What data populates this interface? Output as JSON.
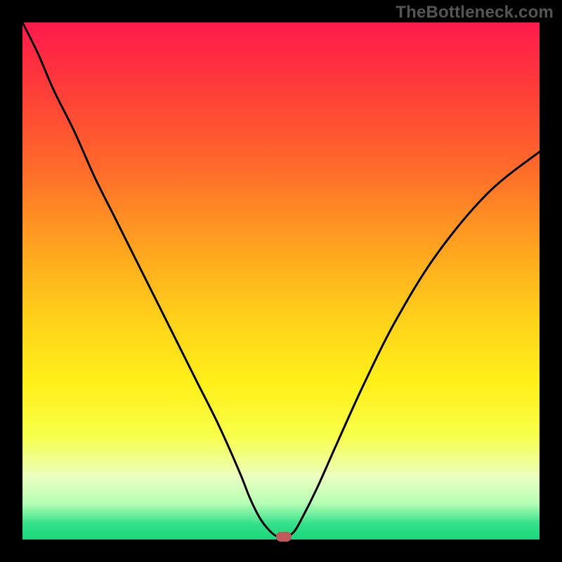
{
  "watermark": "TheBottleneck.com",
  "colors": {
    "frame": "#000000",
    "curve": "#000000",
    "marker": "#c05a5a"
  },
  "chart_data": {
    "type": "line",
    "title": "",
    "xlabel": "",
    "ylabel": "",
    "xlim": [
      0,
      100
    ],
    "ylim": [
      0,
      100
    ],
    "grid": false,
    "legend": false,
    "series": [
      {
        "name": "bottleneck-curve",
        "x": [
          0,
          3,
          6,
          10,
          14,
          18,
          22,
          26,
          30,
          34,
          38,
          42,
          44,
          46,
          48,
          49.5,
          51,
          52.5,
          54,
          57,
          61,
          66,
          72,
          80,
          90,
          100
        ],
        "y": [
          100,
          94,
          87,
          79,
          70,
          62,
          54,
          46,
          38,
          30,
          22,
          13,
          8,
          4,
          1.5,
          0.5,
          0.5,
          1.5,
          4,
          10,
          19,
          30,
          42,
          55,
          67,
          75
        ]
      }
    ],
    "marker": {
      "x": 50.5,
      "y": 0.5
    },
    "gradient_stops": [
      {
        "pos": 0.0,
        "color": "#ff1a4d"
      },
      {
        "pos": 0.12,
        "color": "#ff3a3a"
      },
      {
        "pos": 0.28,
        "color": "#ff6a2a"
      },
      {
        "pos": 0.44,
        "color": "#ffa51f"
      },
      {
        "pos": 0.58,
        "color": "#ffd31a"
      },
      {
        "pos": 0.7,
        "color": "#fff01a"
      },
      {
        "pos": 0.8,
        "color": "#f8ff4a"
      },
      {
        "pos": 0.88,
        "color": "#eaffc0"
      },
      {
        "pos": 0.93,
        "color": "#b6ffb6"
      },
      {
        "pos": 0.97,
        "color": "#33e08a"
      },
      {
        "pos": 1.0,
        "color": "#1ad67a"
      }
    ]
  }
}
